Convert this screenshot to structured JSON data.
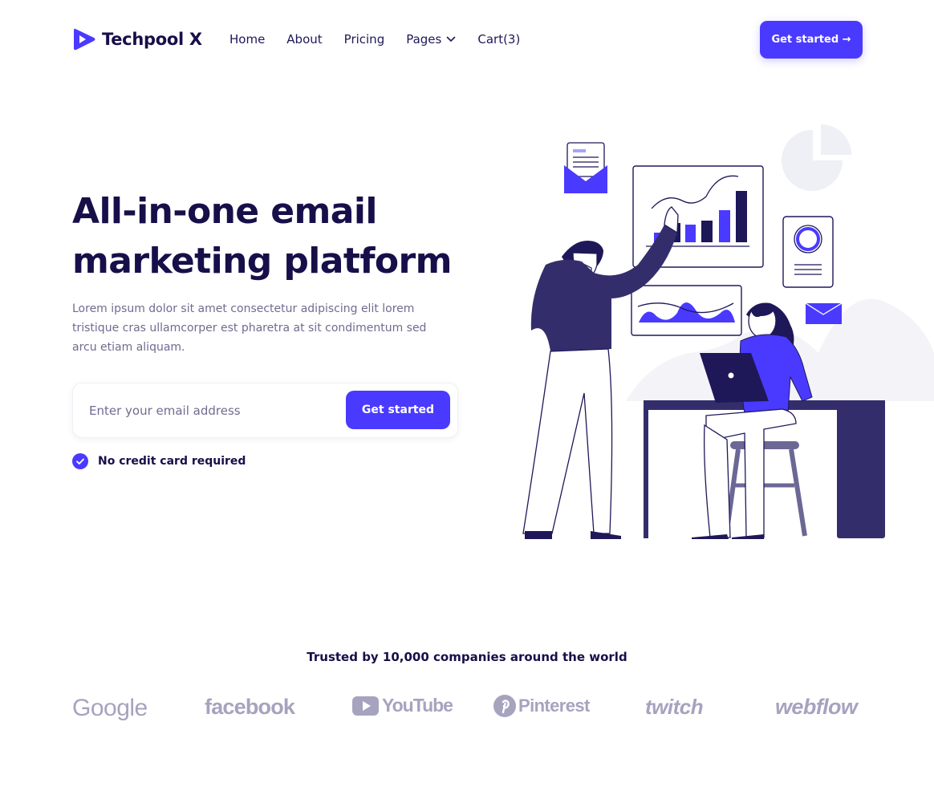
{
  "header": {
    "brand": "Techpool X",
    "nav": [
      {
        "label": "Home"
      },
      {
        "label": "About"
      },
      {
        "label": "Pricing"
      },
      {
        "label": "Pages"
      },
      {
        "label": "Cart(3)"
      }
    ],
    "cta_label": "Get started →"
  },
  "hero": {
    "title_line1": "All-in-one email",
    "title_line2": "marketing platform",
    "description": "Lorem ipsum dolor sit amet consectetur adipiscing elit lorem tristique cras ullamcorper est pharetra at sit condimentum sed arcu etiam aliquam.",
    "email_placeholder": "Enter your email address",
    "submit_label": "Get started",
    "note": "No credit card required"
  },
  "trusted": {
    "heading": "Trusted by 10,000 companies around the world",
    "logos": [
      "Google",
      "facebook",
      "YouTube",
      "Pinterest",
      "twitch",
      "webflow"
    ]
  },
  "colors": {
    "primary": "#4a3aff",
    "heading": "#170f49",
    "body_text": "#6f6c90",
    "logo_gray": "#a6a3bf",
    "illustration_dark": "#332e6b"
  }
}
